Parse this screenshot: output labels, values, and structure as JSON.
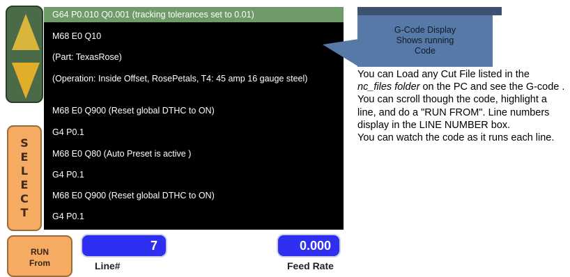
{
  "code_display": {
    "lines": [
      "G64 P0.010 Q0.001 (tracking tolerances set to 0.01)",
      "M68 E0 Q10",
      "(Part: TexasRose)",
      "(Operation: Inside Offset, RosePetals, T4: 45 amp 16 gauge steel)",
      "M68 E0 Q900  (Reset global DTHC to ON)",
      "G4 P0.1",
      "M68 E0 Q80  (Auto Preset is active )",
      "G4 P0.1",
      "M68 E0 Q900  (Reset global DTHC to ON)",
      "G4 P0.1"
    ]
  },
  "controls": {
    "up_icon": "arrow-up-icon",
    "down_icon": "arrow-down-icon",
    "select_letters": [
      "S",
      "E",
      "L",
      "E",
      "C",
      "T"
    ],
    "run_from_line1": "RUN",
    "run_from_line2": "From",
    "line_number_value": "7",
    "line_number_label": "Line#",
    "feed_rate_value": "0.000",
    "feed_rate_label": "Feed Rate"
  },
  "callout": {
    "line1": "G-Code Display",
    "line2": "Shows running",
    "line3": "Code"
  },
  "description": {
    "part1": "You can Load any Cut File listed in the ",
    "folder": "nc_files folder",
    "part2": " on the PC and see the G-code .   You can scroll though the code, highlight a line, and do a \"RUN FROM\". Line numbers display in the LINE NUMBER box.",
    "part3": "You can watch the code as it runs each line."
  },
  "colors": {
    "highlight": "#6f9a6a",
    "orange_button": "#f5ab62",
    "blue_box": "#2f2ff2",
    "callout": "#5679a7"
  }
}
